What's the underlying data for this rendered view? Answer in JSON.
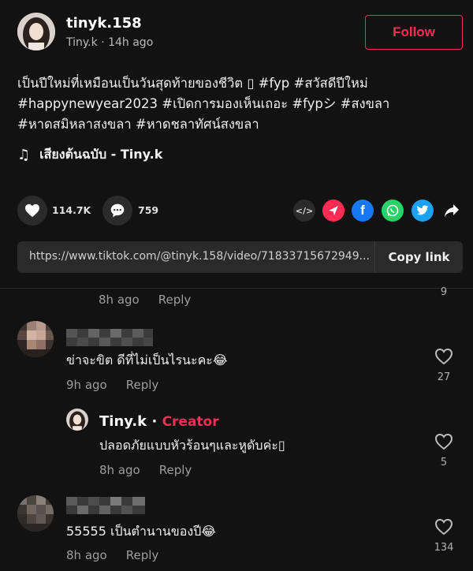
{
  "post": {
    "username": "tinyk.158",
    "display_name": "Tiny.k",
    "time_ago": "14h ago",
    "follow_label": "Follow",
    "caption_line1": "เป็นปีใหม่ที่เหมือนเป็นวันสุดท้ายของชีวิต ▯ #fyp #สวัสดีปีใหม่",
    "caption_line2": "#happynewyear2023 #เปิดการมองเห็นเถอะ #fypシ #สงขลา",
    "caption_line3": "#หาดสมิหลาสงขลา #หาดชลาทัศน์สงขลา",
    "music_label": "เสียงต้นฉบับ - Tiny.k"
  },
  "actions": {
    "likes": "114.7K",
    "comments": "759"
  },
  "share_icons": [
    "embed-icon",
    "send-icon",
    "facebook-icon",
    "whatsapp-icon",
    "twitter-icon",
    "share-arrow-icon"
  ],
  "link": {
    "url": "https://www.tiktok.com/@tinyk.158/video/71833715672949...",
    "copy_label": "Copy link"
  },
  "comments": {
    "prev": {
      "time": "8h ago",
      "reply": "Reply",
      "likes": "9"
    },
    "c1": {
      "text": "ข่าจะขิต ดีที่ไม่เป็นไรนะคะ😂",
      "time": "9h ago",
      "reply": "Reply",
      "likes": "27"
    },
    "c1_reply": {
      "name": "Tiny.k",
      "badge": "Creator",
      "sep": "·",
      "text": "ปลอดภัยแบบหัวร้อนๆและหูดับค่ะ▯",
      "time": "8h ago",
      "reply": "Reply",
      "likes": "5"
    },
    "c2": {
      "text": "55555 เป็นตำนานของปี😂",
      "time": "8h ago",
      "reply": "Reply",
      "likes": "134"
    }
  },
  "colors": {
    "accent": "#fe2c55",
    "background": "#121212"
  }
}
